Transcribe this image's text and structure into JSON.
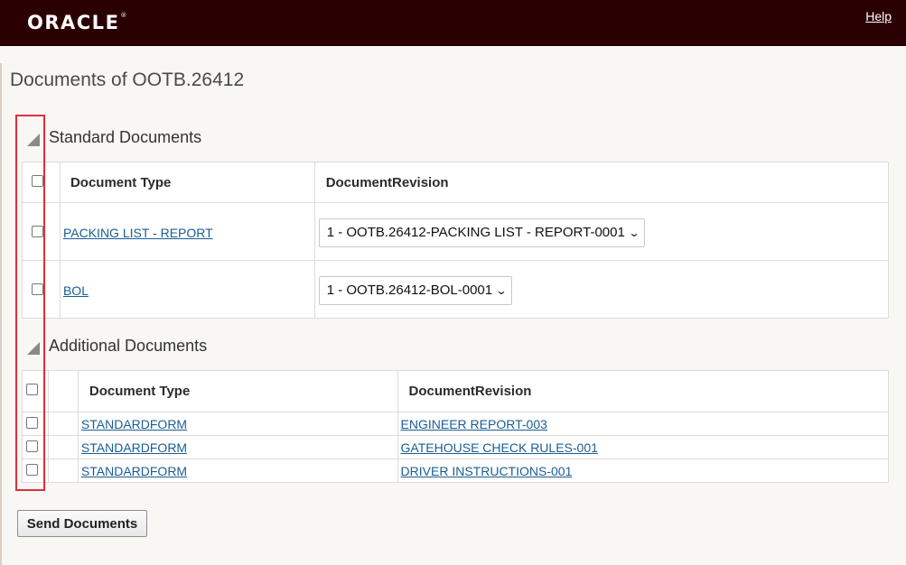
{
  "header": {
    "logo_text": "ORACLE",
    "logo_mark": "®",
    "help_label": "Help",
    "background_color": "#2b0003"
  },
  "page": {
    "title": "Documents of OOTB.26412"
  },
  "standard_documents": {
    "section_title": "Standard Documents",
    "columns": [
      "Document Type",
      "DocumentRevision"
    ],
    "rows": [
      {
        "document_type": "PACKING LIST - REPORT",
        "revision_selected": "1 - OOTB.26412-PACKING LIST - REPORT-0001"
      },
      {
        "document_type": "BOL",
        "revision_selected": "1 - OOTB.26412-BOL-0001"
      }
    ]
  },
  "additional_documents": {
    "section_title": "Additional Documents",
    "columns": [
      "Document Type",
      "DocumentRevision"
    ],
    "rows": [
      {
        "document_type": "STANDARDFORM",
        "revision": "ENGINEER REPORT-003"
      },
      {
        "document_type": "STANDARDFORM",
        "revision": "GATEHOUSE CHECK RULES-001"
      },
      {
        "document_type": "STANDARDFORM",
        "revision": "DRIVER INSTRUCTIONS-001"
      }
    ]
  },
  "actions": {
    "send_label": "Send Documents"
  },
  "icons": {
    "collapse": "triangle-collapse-icon",
    "dropdown": "chevron-down-icon"
  },
  "colors": {
    "link": "#1a5d94",
    "highlight_box": "#e0303a"
  }
}
